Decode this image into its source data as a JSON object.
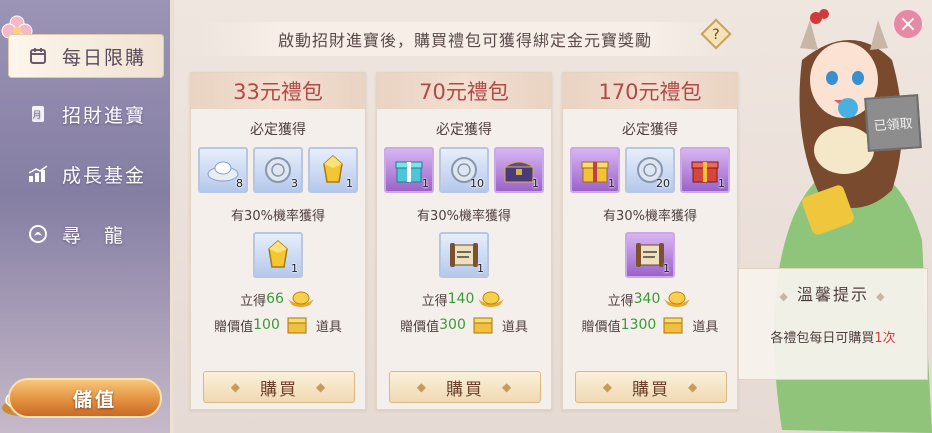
{
  "sidebar": {
    "items": [
      {
        "label": "每日限購",
        "icon": "calendar-icon",
        "active": true
      },
      {
        "label": "招財進寶",
        "icon": "scroll-icon",
        "active": false
      },
      {
        "label": "成長基金",
        "icon": "growth-chart-icon",
        "active": false
      },
      {
        "label": "尋　龍",
        "icon": "dragon-icon",
        "active": false
      }
    ],
    "deposit_label": "儲值"
  },
  "banner_text": "啟動招財進寶後，購買禮包可獲得綁定金元寶獎勵",
  "close_label": "×",
  "help_label": "?",
  "packs": [
    {
      "title": "33元禮包",
      "guaranteed_label": "必定獲得",
      "items": [
        {
          "icon": "silver-ingot-icon",
          "count": "8",
          "quality": "blue"
        },
        {
          "icon": "silver-coin-icon",
          "count": "3",
          "quality": "blue"
        },
        {
          "icon": "gold-gem-icon",
          "count": "1",
          "quality": "blue"
        }
      ],
      "chance_label": "有30%機率獲得",
      "chance_item": {
        "icon": "gold-gem-icon",
        "count": "1",
        "quality": "blue"
      },
      "reward_prefix": "立得",
      "reward_amount": "66",
      "value_prefix": "贈價值",
      "value_amount": "100",
      "value_suffix": "道具",
      "buy_label": "購買"
    },
    {
      "title": "70元禮包",
      "guaranteed_label": "必定獲得",
      "items": [
        {
          "icon": "gift-box-icon",
          "count": "1",
          "quality": "purple"
        },
        {
          "icon": "silver-coin-icon",
          "count": "10",
          "quality": "blue"
        },
        {
          "icon": "treasure-chest-icon",
          "count": "1",
          "quality": "purple"
        }
      ],
      "chance_label": "有30%機率獲得",
      "chance_item": {
        "icon": "scroll-icon",
        "count": "1",
        "quality": "blue"
      },
      "reward_prefix": "立得",
      "reward_amount": "140",
      "value_prefix": "贈價值",
      "value_amount": "300",
      "value_suffix": "道具",
      "buy_label": "購買"
    },
    {
      "title": "170元禮包",
      "guaranteed_label": "必定獲得",
      "items": [
        {
          "icon": "gold-gift-box-icon",
          "count": "1",
          "quality": "purple"
        },
        {
          "icon": "silver-coin-icon",
          "count": "20",
          "quality": "blue"
        },
        {
          "icon": "red-gift-box-icon",
          "count": "1",
          "quality": "purple"
        }
      ],
      "chance_label": "有30%機率獲得",
      "chance_item": {
        "icon": "scroll-icon",
        "count": "1",
        "quality": "purple"
      },
      "reward_prefix": "立得",
      "reward_amount": "340",
      "value_prefix": "贈價值",
      "value_amount": "1300",
      "value_suffix": "道具",
      "buy_label": "購買"
    }
  ],
  "claimed_badge": "已領取",
  "tips": {
    "title": "溫馨提示",
    "text_prefix": "各禮包每日可購買",
    "text_highlight": "1次"
  },
  "colors": {
    "accent_red": "#b34848",
    "green_number": "#3a9a3a",
    "highlight_red": "#d33a3a",
    "deposit_orange": "#e39140"
  }
}
